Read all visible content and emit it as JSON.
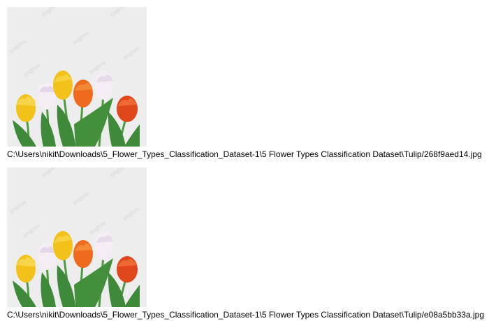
{
  "images": [
    {
      "icon": "tulip-bouquet-image",
      "watermark": "pngtree",
      "path": "C:\\Users\\nikit\\Downloads\\5_Flower_Types_Classification_Dataset-1\\5 Flower Types Classification Dataset\\Tulip/268f9aed14.jpg"
    },
    {
      "icon": "tulip-bouquet-image",
      "watermark": "pngtree",
      "path": "C:\\Users\\nikit\\Downloads\\5_Flower_Types_Classification_Dataset-1\\5 Flower Types Classification Dataset\\Tulip/e08a5bb33a.jpg"
    }
  ],
  "colors": {
    "background": "#eeeeee",
    "leaf": "#3f8a3a",
    "stem": "#4f9a42",
    "yellow": "#f2c21b",
    "white": "#f4eef4",
    "orange": "#f06a1e",
    "red": "#e0481c"
  }
}
